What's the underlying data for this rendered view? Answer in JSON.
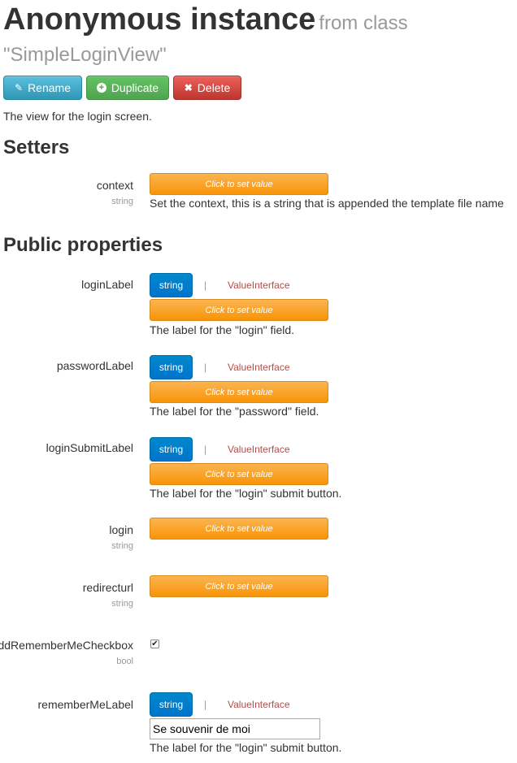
{
  "header": {
    "title": "Anonymous instance",
    "from_label": "from class",
    "class_name": "\"SimpleLoginView\""
  },
  "actions": {
    "rename": "Rename",
    "duplicate": "Duplicate",
    "delete": "Delete"
  },
  "description": "The view for the login screen.",
  "setters": {
    "heading": "Setters",
    "items": [
      {
        "name": "context",
        "type": "string",
        "value_label": "Click to set value",
        "help": "Set the context, this is a string that is appended the template file name"
      }
    ]
  },
  "public_properties": {
    "heading": "Public properties",
    "separator": "|",
    "items": [
      {
        "name": "loginLabel",
        "type_button": "string",
        "alt_type": "ValueInterface",
        "value_label": "Click to set value",
        "help": "The label for the \"login\" field."
      },
      {
        "name": "passwordLabel",
        "type_button": "string",
        "alt_type": "ValueInterface",
        "value_label": "Click to set value",
        "help": "The label for the \"password\" field."
      },
      {
        "name": "loginSubmitLabel",
        "type_button": "string",
        "alt_type": "ValueInterface",
        "value_label": "Click to set value",
        "help": "The label for the \"login\" submit button."
      },
      {
        "name": "login",
        "type": "string",
        "value_label": "Click to set value"
      },
      {
        "name": "redirecturl",
        "type": "string",
        "value_label": "Click to set value"
      },
      {
        "name": "addRememberMeCheckbox",
        "type": "bool",
        "checked": true
      },
      {
        "name": "rememberMeLabel",
        "type_button": "string",
        "alt_type": "ValueInterface",
        "value": "Se souvenir de moi",
        "help": "The label for the \"login\" submit button."
      }
    ]
  },
  "colors": {
    "info": "#49afcd",
    "success": "#5bb75b",
    "danger": "#da4f49",
    "warning": "#faa732",
    "primary": "#0088cc",
    "value_interface": "#b94a48"
  }
}
